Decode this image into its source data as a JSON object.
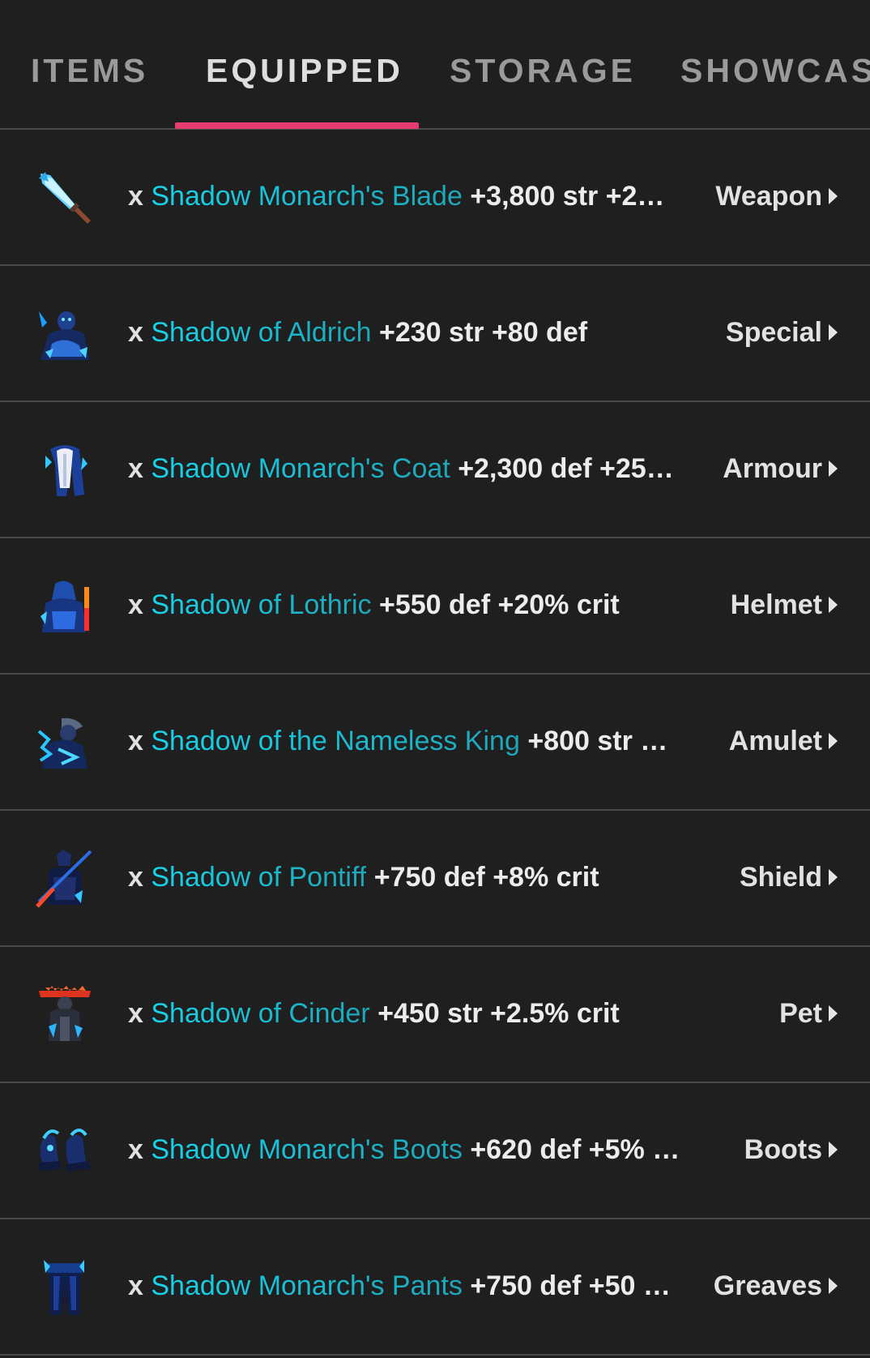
{
  "tabs": [
    {
      "label": "ITEMS",
      "active": false
    },
    {
      "label": "EQUIPPED",
      "active": true
    },
    {
      "label": "STORAGE",
      "active": false
    },
    {
      "label": "SHOWCASE",
      "active": false
    }
  ],
  "accent_color": "#e63b6f",
  "name_color": "#1ec6dc",
  "items": [
    {
      "qty": "x",
      "name": "Shadow Monarch's Blade",
      "stats": "+3,800 str +2…",
      "slot": "Weapon",
      "icon": "sword-icon"
    },
    {
      "qty": "x",
      "name": "Shadow of Aldrich",
      "stats": "+230 str +80 def",
      "slot": "Special",
      "icon": "shadow-knight-icon"
    },
    {
      "qty": "x",
      "name": "Shadow Monarch's Coat",
      "stats": "+2,300 def +25…",
      "slot": "Armour",
      "icon": "coat-icon"
    },
    {
      "qty": "x",
      "name": "Shadow of Lothric",
      "stats": "+550 def +20% crit",
      "slot": "Helmet",
      "icon": "hooded-knight-icon"
    },
    {
      "qty": "x",
      "name": "Shadow of the Nameless King",
      "stats": "+800 str …",
      "slot": "Amulet",
      "icon": "shadow-king-icon"
    },
    {
      "qty": "x",
      "name": "Shadow of Pontiff",
      "stats": "+750 def +8% crit",
      "slot": "Shield",
      "icon": "spear-knight-icon"
    },
    {
      "qty": "x",
      "name": "Shadow of Cinder",
      "stats": "+450 str +2.5% crit",
      "slot": "Pet",
      "icon": "flame-crown-knight-icon"
    },
    {
      "qty": "x",
      "name": "Shadow Monarch's Boots",
      "stats": "+620 def +5% …",
      "slot": "Boots",
      "icon": "boots-icon"
    },
    {
      "qty": "x",
      "name": "Shadow Monarch's Pants",
      "stats": "+750 def +50 …",
      "slot": "Greaves",
      "icon": "pants-icon"
    }
  ]
}
